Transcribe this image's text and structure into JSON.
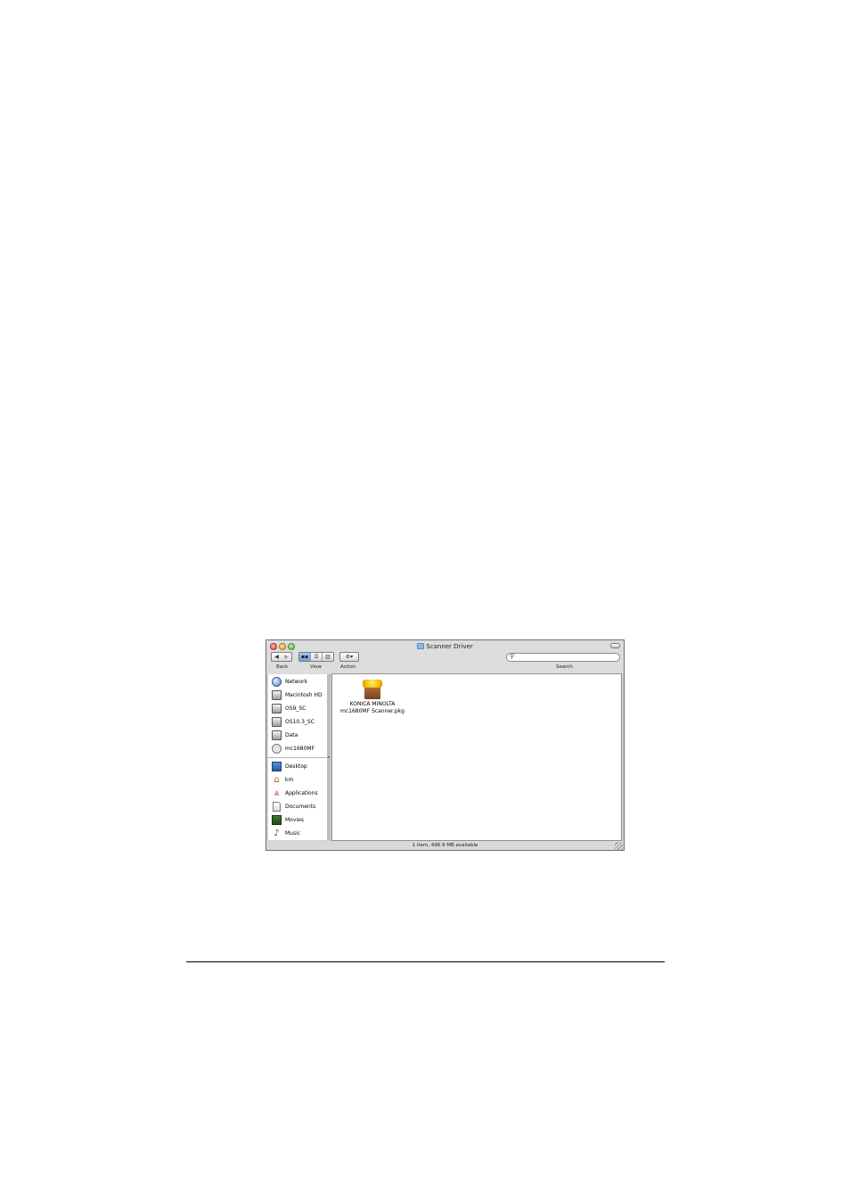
{
  "window": {
    "title": "Scanner Driver",
    "status": "1 item, 496.9 MB available"
  },
  "toolbar": {
    "back_glyph": "◀",
    "forward_glyph": "▶",
    "view_icon_glyph": "▪▪",
    "view_list_glyph": "☰",
    "view_column_glyph": "▥",
    "action_glyph": "⚙▾",
    "search_glyph": "⚲",
    "back_label": "Back",
    "view_label": "View",
    "action_label": "Action",
    "search_label": "Search",
    "search_value": ""
  },
  "sidebar": {
    "devices": [
      {
        "label": "Network",
        "icon": "network-globe-icon"
      },
      {
        "label": "Macintosh HD",
        "icon": "hard-disk-icon"
      },
      {
        "label": "OS9_SC",
        "icon": "hard-disk-icon"
      },
      {
        "label": "OS10.3_SC",
        "icon": "hard-disk-icon"
      },
      {
        "label": "Data",
        "icon": "hard-disk-icon"
      },
      {
        "label": "mc1680MF",
        "icon": "cd-disc-icon"
      }
    ],
    "places": [
      {
        "label": "Desktop",
        "icon": "desktop-icon"
      },
      {
        "label": "km",
        "icon": "home-icon"
      },
      {
        "label": "Applications",
        "icon": "applications-icon"
      },
      {
        "label": "Documents",
        "icon": "documents-icon"
      },
      {
        "label": "Movies",
        "icon": "movies-icon"
      },
      {
        "label": "Music",
        "icon": "music-icon"
      }
    ]
  },
  "content": {
    "items": [
      {
        "name_line1": "KONICA MINOLTA",
        "name_line2": "mc1680MF Scanner.pkg",
        "icon": "package-icon"
      }
    ]
  }
}
